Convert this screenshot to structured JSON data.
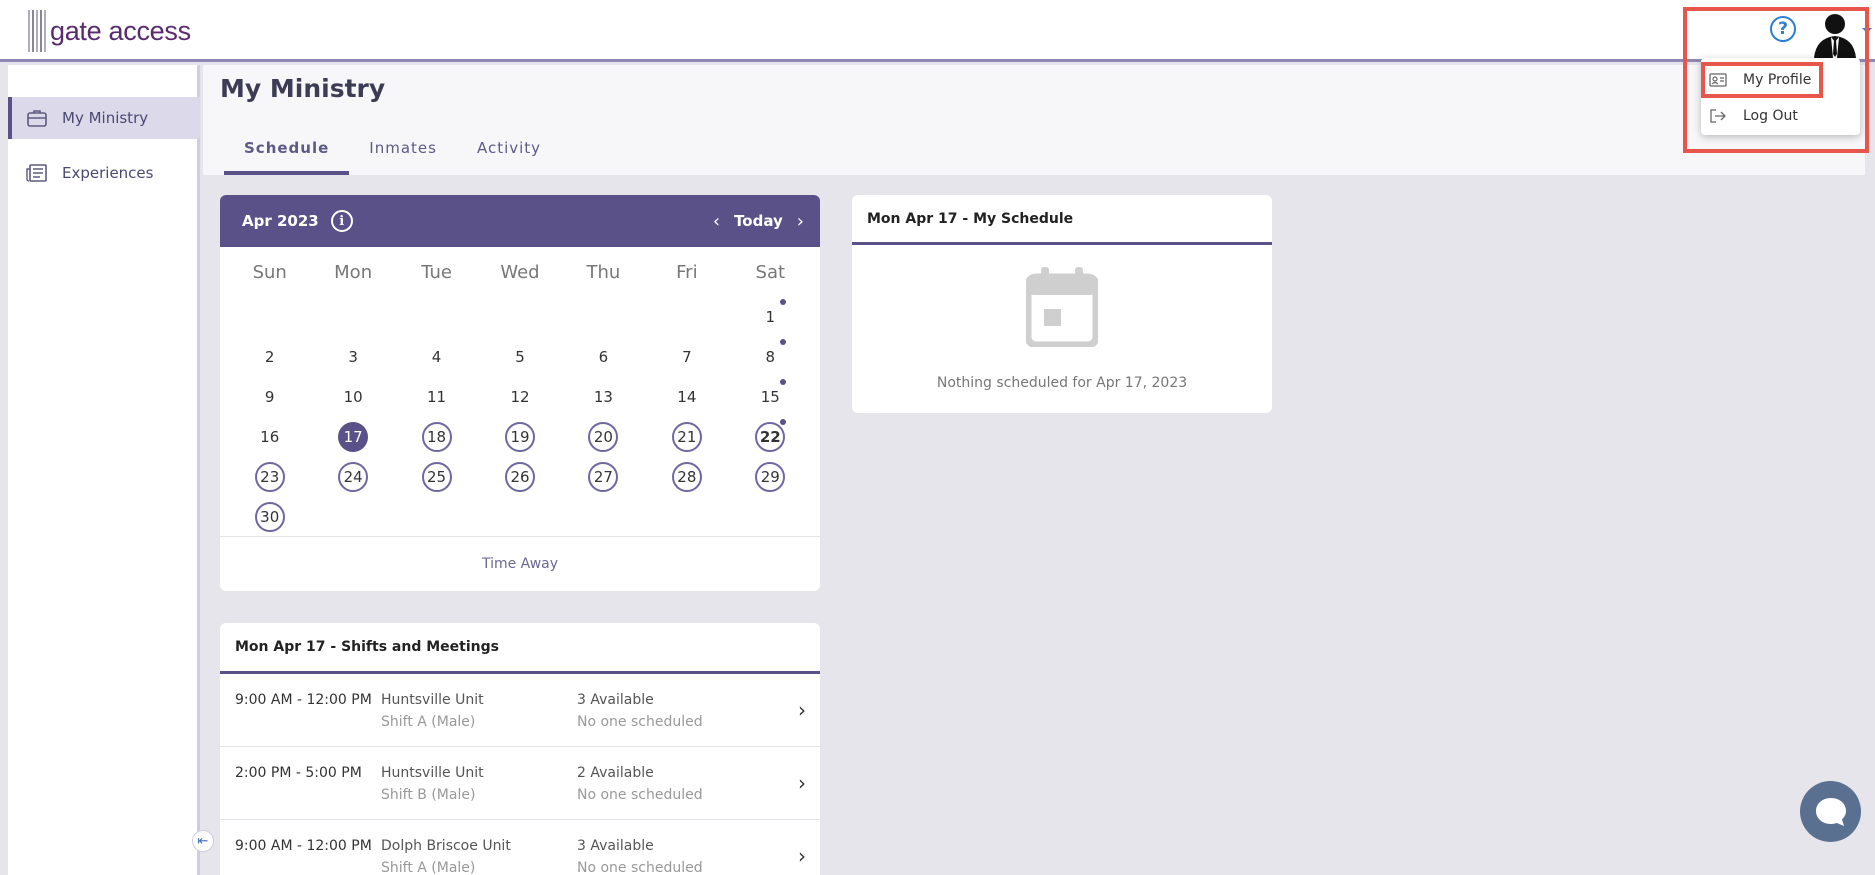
{
  "app": {
    "logo_text": "gate access"
  },
  "header": {
    "help_icon": "question-circle-icon",
    "avatar": "user-avatar"
  },
  "profile_menu": {
    "items": [
      {
        "label": "My Profile",
        "icon": "id-card-icon"
      },
      {
        "label": "Log Out",
        "icon": "logout-icon"
      }
    ]
  },
  "sidebar": {
    "items": [
      {
        "label": "My Ministry",
        "icon": "briefcase-icon",
        "active": true
      },
      {
        "label": "Experiences",
        "icon": "newspaper-icon",
        "active": false
      }
    ]
  },
  "page": {
    "title": "My Ministry",
    "tabs": [
      {
        "label": "Schedule",
        "active": true
      },
      {
        "label": "Inmates",
        "active": false
      },
      {
        "label": "Activity",
        "active": false
      }
    ]
  },
  "calendar": {
    "month": "Apr 2023",
    "today_label": "Today",
    "weekdays": [
      "Sun",
      "Mon",
      "Tue",
      "Wed",
      "Thu",
      "Fri",
      "Sat"
    ],
    "days": [
      "",
      "",
      "",
      "",
      "",
      "",
      "1",
      "2",
      "3",
      "4",
      "5",
      "6",
      "7",
      "8",
      "9",
      "10",
      "11",
      "12",
      "13",
      "14",
      "15",
      "16",
      "17",
      "18",
      "19",
      "20",
      "21",
      "22",
      "23",
      "24",
      "25",
      "26",
      "27",
      "28",
      "29",
      "30"
    ],
    "selected_day": "17",
    "days_with_events": [
      "1",
      "8",
      "15",
      "22"
    ],
    "footer_link": "Time Away",
    "accent": "#5b5189"
  },
  "my_schedule": {
    "title": "Mon Apr 17 - My Schedule",
    "empty_text": "Nothing scheduled for Apr 17, 2023",
    "icon": "calendar-icon"
  },
  "shifts": {
    "title": "Mon Apr 17 - Shifts and Meetings",
    "rows": [
      {
        "time": "9:00 AM - 12:00 PM",
        "unit": "Huntsville Unit",
        "shift": "Shift A (Male)",
        "available": "3 Available",
        "scheduled": "No one scheduled"
      },
      {
        "time": "2:00 PM - 5:00 PM",
        "unit": "Huntsville Unit",
        "shift": "Shift B (Male)",
        "available": "2 Available",
        "scheduled": "No one scheduled"
      },
      {
        "time": "9:00 AM - 12:00 PM",
        "unit": "Dolph Briscoe Unit",
        "shift": "Shift A (Male)",
        "available": "3 Available",
        "scheduled": "No one scheduled"
      }
    ]
  },
  "chat": {
    "icon": "chat-bubble-icon"
  }
}
